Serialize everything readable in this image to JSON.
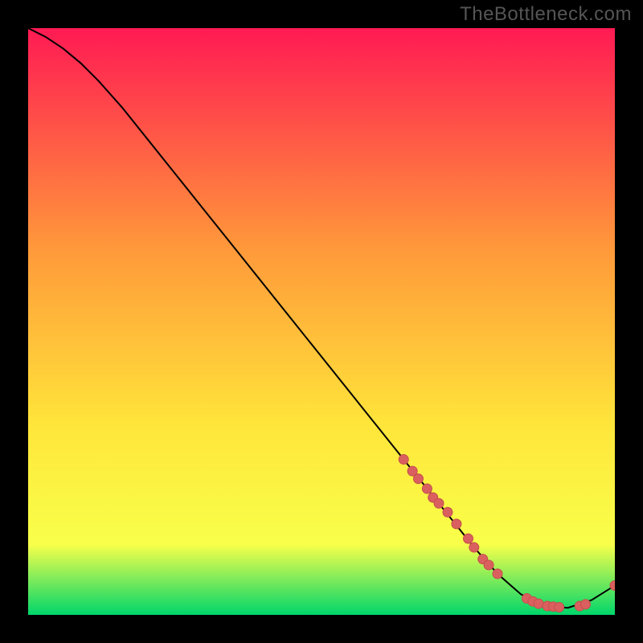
{
  "watermark": "TheBottleneck.com",
  "colors": {
    "gradient_top": "#ff1a53",
    "gradient_mid1": "#ff9a3a",
    "gradient_mid2": "#ffe63a",
    "gradient_mid3": "#f8ff4a",
    "gradient_bottom": "#00d66b",
    "line": "#000000",
    "marker_fill": "#d9605e",
    "marker_stroke": "#c64e4c"
  },
  "chart_data": {
    "type": "line",
    "title": "",
    "xlabel": "",
    "ylabel": "",
    "xlim": [
      0,
      100
    ],
    "ylim": [
      0,
      100
    ],
    "grid": false,
    "legend": false,
    "series": [
      {
        "name": "curve",
        "x": [
          0,
          3,
          6,
          9,
          12,
          16,
          20,
          24,
          28,
          32,
          36,
          40,
          44,
          48,
          52,
          56,
          60,
          64,
          68,
          72,
          76,
          80,
          84,
          88,
          92,
          96,
          100
        ],
        "y": [
          100,
          98.5,
          96.5,
          94,
          91,
          86.5,
          81.5,
          76.5,
          71.5,
          66.5,
          61.5,
          56.5,
          51.5,
          46.5,
          41.5,
          36.5,
          31.5,
          26.5,
          21.5,
          16.5,
          11.5,
          7,
          3.5,
          1.5,
          1.2,
          2.5,
          5
        ]
      }
    ],
    "markers": {
      "name": "highlight-points",
      "x": [
        64,
        65.5,
        66.5,
        68,
        69,
        70,
        71.5,
        73,
        75,
        76,
        77.5,
        78.5,
        80,
        85,
        86,
        87,
        88.5,
        89.5,
        90.5,
        94,
        95,
        100
      ],
      "y": [
        26.5,
        24.5,
        23.2,
        21.5,
        20,
        19,
        17.5,
        15.5,
        13,
        11.5,
        9.5,
        8.5,
        7,
        2.8,
        2.3,
        1.9,
        1.5,
        1.4,
        1.3,
        1.5,
        1.8,
        5
      ]
    }
  }
}
